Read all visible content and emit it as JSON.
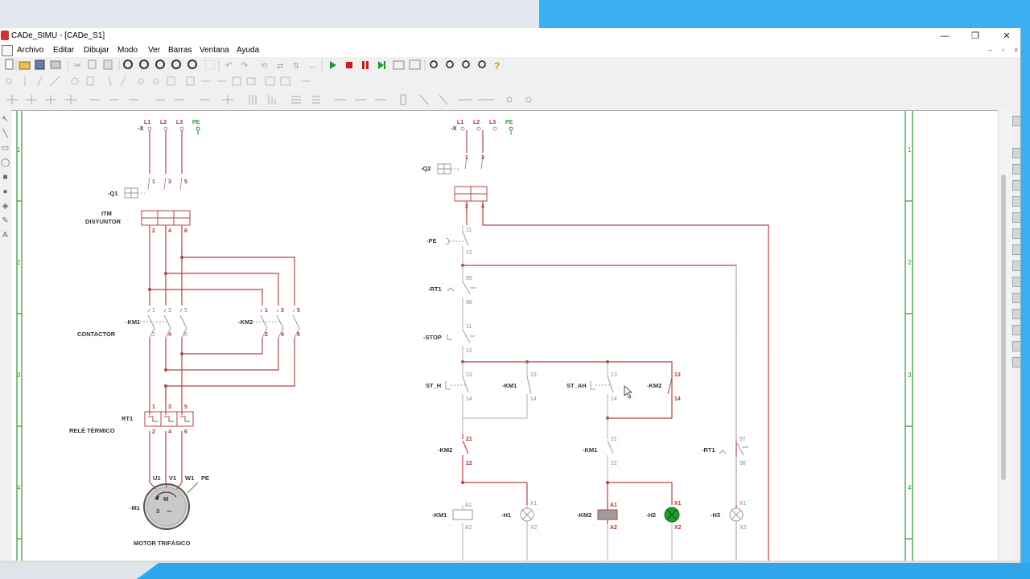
{
  "window": {
    "title": "CADe_SIMU - [CADe_S1]",
    "min": "—",
    "max": "❐",
    "close": "✕"
  },
  "menu": [
    "Archivo",
    "Editar",
    "Dibujar",
    "Modo",
    "Ver",
    "Barras",
    "Ventana",
    "Ayuda"
  ],
  "mdi": {
    "min": "–",
    "restore": "▫",
    "close": "×"
  },
  "colors": {
    "wire": "#b44444",
    "frame": "#2b9a32",
    "lamp_on": "#1f9e2a",
    "coil_on": "#9e9e9e"
  },
  "rows": [
    "1",
    "2",
    "3",
    "4"
  ],
  "power": {
    "lines": [
      "L1",
      "L2",
      "L3",
      "PE"
    ],
    "x_label": "-X",
    "q1": {
      "tag": "-Q1",
      "name1": "ITM",
      "name2": "DISYUNTOR",
      "top": [
        "1",
        "3",
        "5"
      ],
      "bot": [
        "2",
        "4",
        "6"
      ]
    },
    "km1": {
      "tag": "-KM1",
      "name": "CONTACTOR",
      "top": [
        "1",
        "3",
        "5"
      ],
      "bot": [
        "2",
        "4",
        "6"
      ]
    },
    "km2": {
      "tag": "-KM2",
      "top": [
        "1",
        "3",
        "5"
      ],
      "bot": [
        "2",
        "4",
        "6"
      ]
    },
    "rt1": {
      "tag": "RT1",
      "name": "RELÉ TÉRMICO",
      "top": [
        "1",
        "3",
        "5"
      ],
      "bot": [
        "2",
        "4",
        "6"
      ]
    },
    "motor": {
      "tag": "-M1",
      "name": "MOTOR TRIFÁSICO",
      "terms": [
        "U1",
        "V1",
        "W1",
        "PE"
      ],
      "m": "M",
      "three": "3",
      "ac": "~"
    }
  },
  "control": {
    "lines": [
      "L1",
      "L2",
      "L3",
      "PE"
    ],
    "x_label": "-X",
    "q2": {
      "tag": "-Q2",
      "top": [
        "1",
        "3"
      ],
      "bot": [
        "2",
        "4"
      ]
    },
    "pe": {
      "tag": "-PE",
      "n1": "11",
      "n2": "12"
    },
    "rt1": {
      "tag": "-RT1",
      "n1": "95",
      "n2": "96"
    },
    "stop": {
      "tag": "-STOP",
      "n1": "11",
      "n2": "12"
    },
    "st_h": {
      "tag": "ST_H",
      "n1": "13",
      "n2": "14"
    },
    "km1_aux": {
      "tag": "-KM1",
      "n1": "13",
      "n2": "14"
    },
    "st_ah": {
      "tag": "ST_AH",
      "n1": "13",
      "n2": "14"
    },
    "km2_aux": {
      "tag": "-KM2",
      "n1": "13",
      "n2": "14"
    },
    "km2_nc": {
      "tag": "-KM2",
      "n1": "21",
      "n2": "22"
    },
    "km1_nc": {
      "tag": "-KM1",
      "n1": "21",
      "n2": "22"
    },
    "rt1_no": {
      "tag": "-RT1",
      "n1": "97",
      "n2": "98"
    },
    "coil_km1": {
      "tag": "-KM1",
      "a1": "A1",
      "a2": "A2"
    },
    "lamp_h1": {
      "tag": "-H1",
      "x1": "X1",
      "x2": "X2"
    },
    "coil_km2": {
      "tag": "-KM2",
      "a1": "A1",
      "a2": "A2"
    },
    "lamp_h2": {
      "tag": "-H2",
      "x1": "X1",
      "x2": "X2"
    },
    "lamp_h3": {
      "tag": "-H3",
      "x1": "X1",
      "x2": "X2"
    }
  }
}
